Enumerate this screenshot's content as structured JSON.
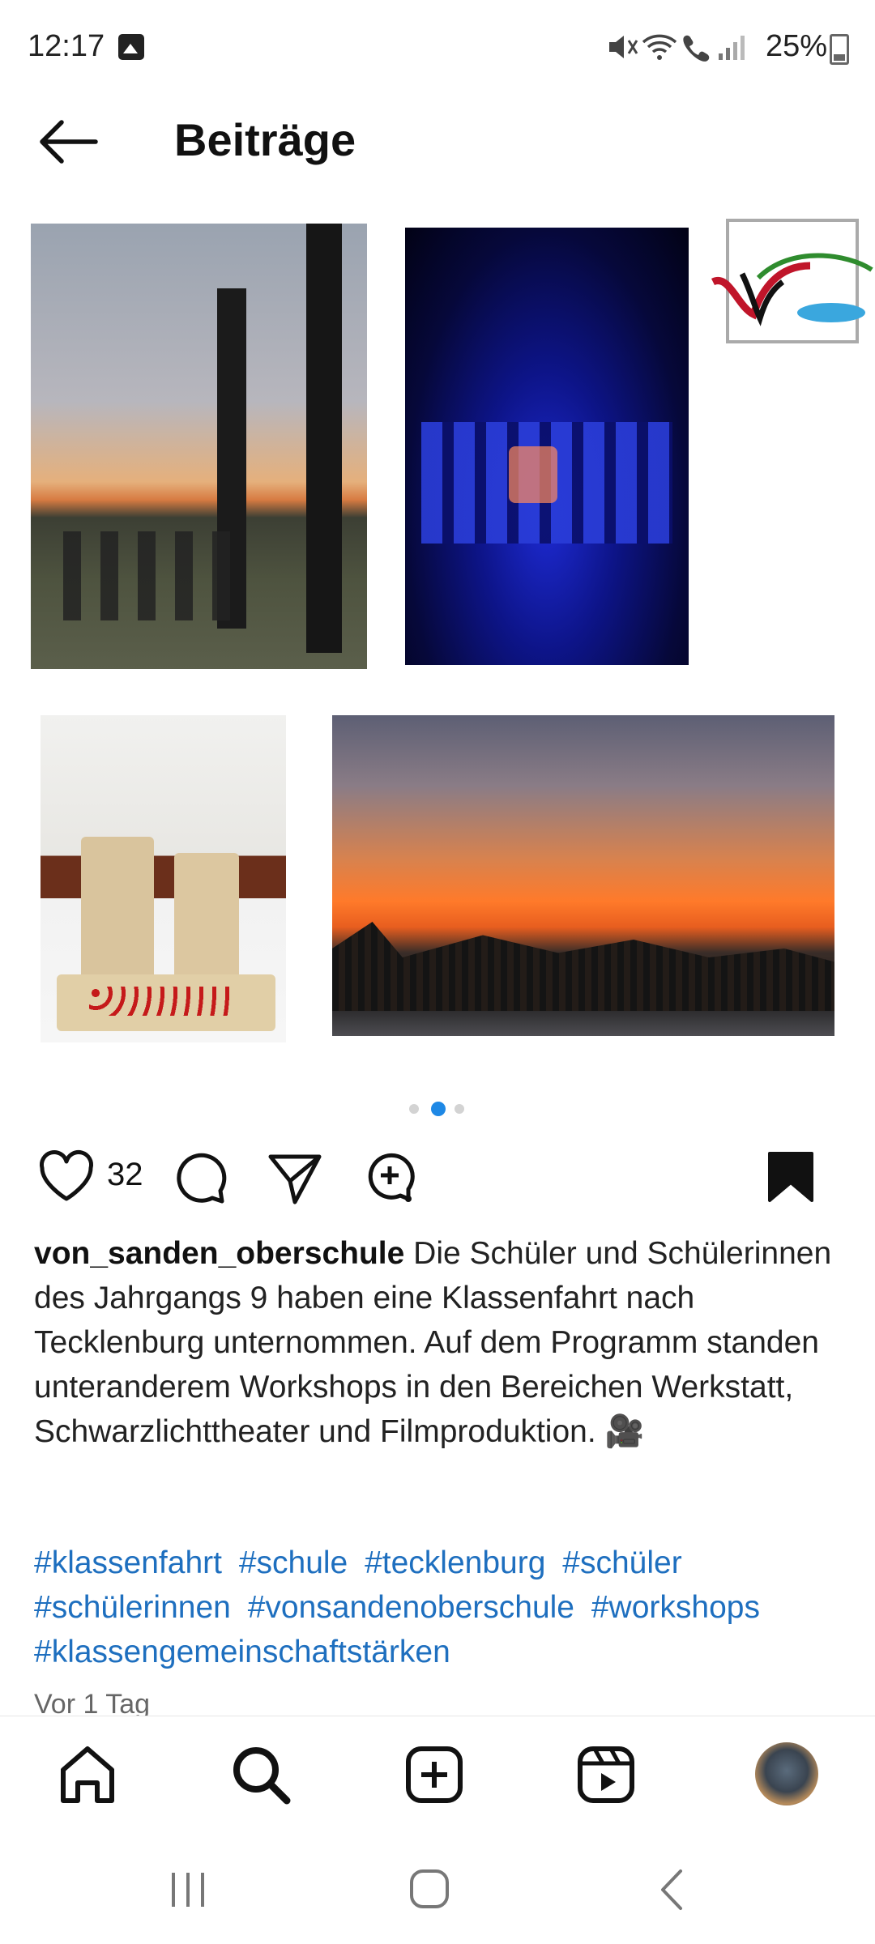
{
  "status_bar": {
    "time": "12:17",
    "battery": "25%",
    "icons": [
      "gallery-icon",
      "mute-icon",
      "wifi-icon",
      "wifi-calling-icon",
      "signal-icon",
      "battery-icon"
    ]
  },
  "header": {
    "title": "Beiträge",
    "back_icon": "arrow-left-icon"
  },
  "gallery": {
    "photos": [
      "tree-group-photo",
      "blacklight-theatre-photo",
      "school-logo",
      "wooden-robots-photo",
      "sunset-photo"
    ],
    "page_count": 3,
    "active_page": 2,
    "active_color": "#1e88e5"
  },
  "actions": {
    "likes": "32",
    "icons": [
      "heart-icon",
      "comment-icon",
      "share-icon",
      "add-comment-icon",
      "saved-bookmark-icon"
    ]
  },
  "post": {
    "username": "von_sanden_oberschule",
    "caption": "Die Schüler und Schülerinnen des Jahrgangs 9 haben eine Klassenfahrt nach Tecklenburg unternommen. Auf dem Programm standen unteranderem Workshops in den Bereichen Werkstatt, Schwarzlichttheater und Filmproduktion. 🎥",
    "hashtags": [
      "#klassenfahrt",
      "#schule",
      "#tecklenburg",
      "#schüler",
      "#schülerinnen",
      "#vonsandenoberschule",
      "#workshops",
      "#klassengemeinschaftstärken"
    ],
    "hashtag_color": "#1e6fbf",
    "timestamp": "Vor 1 Tag"
  },
  "bottom_nav": {
    "items": [
      "home-icon",
      "search-icon",
      "create-icon",
      "reels-icon",
      "profile-avatar"
    ],
    "active": "search-icon"
  },
  "system_nav": {
    "items": [
      "recent-apps-icon",
      "home-button-icon",
      "back-nav-icon"
    ]
  }
}
